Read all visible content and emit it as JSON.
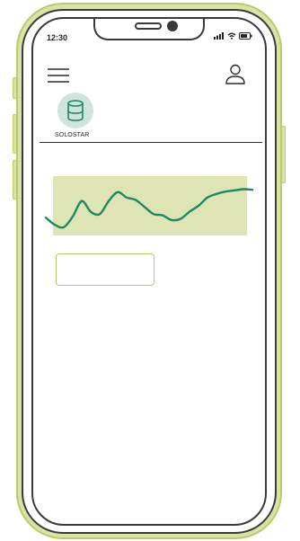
{
  "status_bar": {
    "time": "12:30"
  },
  "app": {
    "label": "SOLOSTAR",
    "icon": "database-icon"
  },
  "header": {
    "menu_icon": "hamburger-menu-icon",
    "profile_icon": "user-profile-icon"
  },
  "chart_data": {
    "type": "line",
    "x": [
      0,
      1,
      2,
      3,
      4,
      5,
      6,
      7,
      8,
      9,
      10,
      11,
      12,
      13,
      14,
      15,
      16,
      17,
      18,
      19,
      20,
      21,
      22,
      23
    ],
    "series": [
      {
        "values": [
          0.3,
          0.18,
          0.14,
          0.32,
          0.58,
          0.4,
          0.36,
          0.58,
          0.73,
          0.64,
          0.6,
          0.48,
          0.36,
          0.34,
          0.26,
          0.28,
          0.4,
          0.5,
          0.64,
          0.7,
          0.74,
          0.76,
          0.78,
          0.77
        ]
      }
    ],
    "band_range": [
      0,
      1
    ],
    "grid": false,
    "colors": {
      "band": "#dfe4b5",
      "line": "#1b8a62"
    }
  },
  "colors": {
    "phone_accent": "#d9e3a6",
    "phone_accent_border": "#bcca6a",
    "outline": "#3a3a3a",
    "app_icon_bg": "#cfe4dc",
    "app_icon_fg": "#1b8a62"
  }
}
